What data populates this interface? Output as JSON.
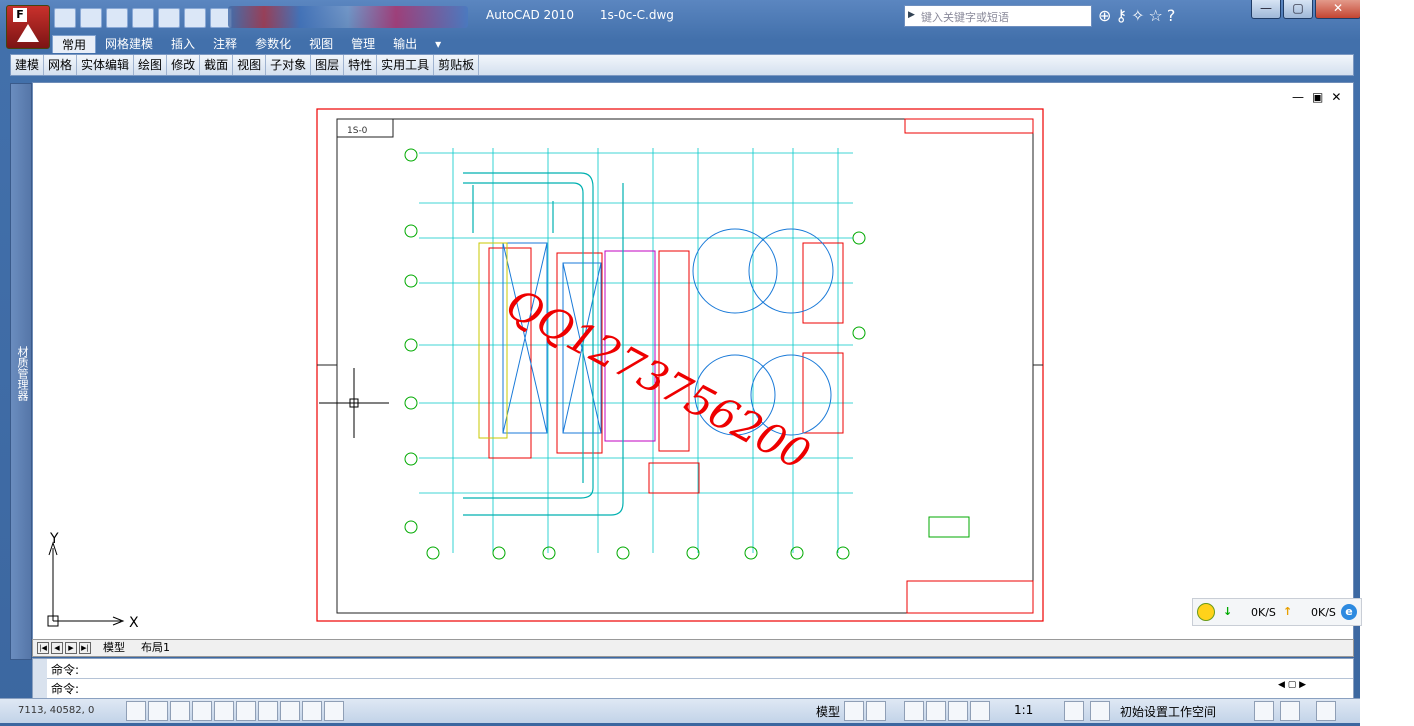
{
  "titlebar": {
    "app": "AutoCAD 2010",
    "file": "1s-0c-C.dwg",
    "search_placeholder": "键入关键字或短语"
  },
  "window_buttons": {
    "minimize": "—",
    "restore": "▢",
    "close": "✕"
  },
  "menu": [
    "常用",
    "网格建模",
    "插入",
    "注释",
    "参数化",
    "视图",
    "管理",
    "输出"
  ],
  "toolbar": [
    "建模",
    "网格",
    "实体编辑",
    "绘图",
    "修改",
    "截面",
    "视图",
    "子对象",
    "图层",
    "特性",
    "实用工具",
    "剪贴板"
  ],
  "left_panel": "材质管理器",
  "viewport_controls": [
    "—",
    "▣",
    "✕"
  ],
  "drawing": {
    "title_block": "1S-0",
    "watermark": "QQ1273756200"
  },
  "ucs": {
    "x": "X",
    "y": "Y"
  },
  "tabs": [
    "模型",
    "布局1"
  ],
  "command": {
    "line1": "命令:",
    "line2": "命令:"
  },
  "status": {
    "coords": "7113, 40582, 0",
    "model": "模型",
    "scale": "1:1",
    "workspace": "初始设置工作空间"
  },
  "netmon": {
    "down": "0K/S",
    "up": "0K/S"
  }
}
